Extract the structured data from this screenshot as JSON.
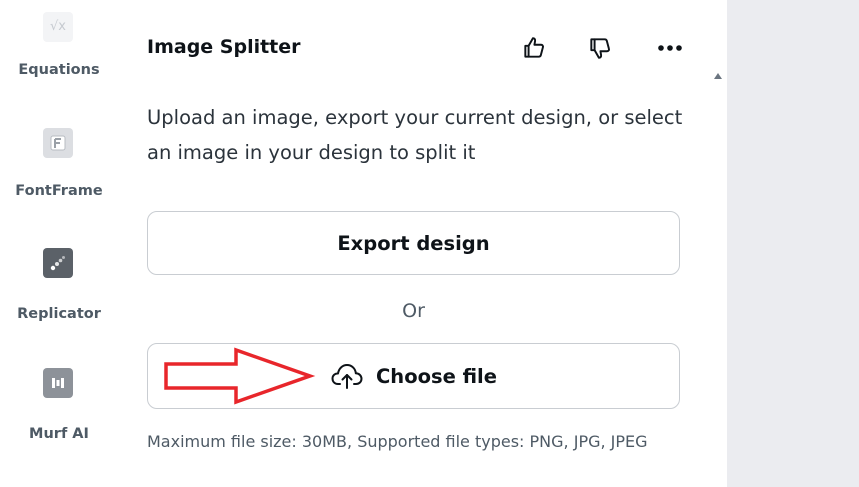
{
  "rail": {
    "items": [
      {
        "label": "Equations",
        "icon": "equations-icon"
      },
      {
        "label": "FontFrame",
        "icon": "fontframe-icon"
      },
      {
        "label": "Replicator",
        "icon": "replicator-icon"
      },
      {
        "label": "Murf AI",
        "icon": "murf-ai-icon"
      }
    ]
  },
  "panel": {
    "title": "Image Splitter",
    "description": "Upload an image, export your current design, or select an image in your design to split it",
    "export_label": "Export design",
    "or_label": "Or",
    "choose_label": "Choose file",
    "note": "Maximum file size: 30MB, Supported file types: PNG, JPG, JPEG"
  },
  "icons": {
    "like": "thumbs-up-icon",
    "dislike": "thumbs-down-icon",
    "more": "more-icon",
    "upload": "cloud-upload-icon"
  },
  "colors": {
    "annotation": "#e8262b",
    "canvas_bg": "#ebecf0",
    "border": "#c9cdd2"
  }
}
